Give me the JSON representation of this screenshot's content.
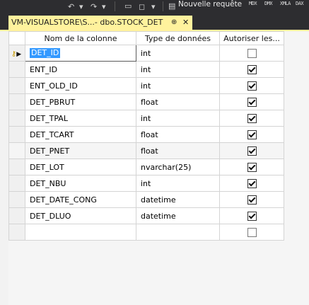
{
  "toolbar": {
    "new_query_label": "Nouvelle requête",
    "mini_labels": [
      "MDX",
      "DMX",
      "XMLA",
      "DAX"
    ]
  },
  "tab": {
    "title": "VM-VISUALSTORE\\S...- dbo.STOCK_DET",
    "pin_glyph": "⊕",
    "close_glyph": "✕"
  },
  "grid": {
    "headers": {
      "name": "Nom de la colonne",
      "type": "Type de données",
      "nulls": "Autoriser les..."
    },
    "rows": [
      {
        "name": "DET_ID",
        "type": "int",
        "allow_nulls": false
      },
      {
        "name": "ENT_ID",
        "type": "int",
        "allow_nulls": true
      },
      {
        "name": "ENT_OLD_ID",
        "type": "int",
        "allow_nulls": true
      },
      {
        "name": "DET_PBRUT",
        "type": "float",
        "allow_nulls": true
      },
      {
        "name": "DET_TPAL",
        "type": "int",
        "allow_nulls": true
      },
      {
        "name": "DET_TCART",
        "type": "float",
        "allow_nulls": true
      },
      {
        "name": "DET_PNET",
        "type": "float",
        "allow_nulls": true
      },
      {
        "name": "DET_LOT",
        "type": "nvarchar(25)",
        "allow_nulls": true
      },
      {
        "name": "DET_NBU",
        "type": "int",
        "allow_nulls": true
      },
      {
        "name": "DET_DATE_CONG",
        "type": "datetime",
        "allow_nulls": true
      },
      {
        "name": "DET_DLUO",
        "type": "datetime",
        "allow_nulls": true
      },
      {
        "name": "",
        "type": "",
        "allow_nulls": false
      }
    ],
    "highlight_color": "#f7ef00",
    "selection_color": "#3399ff"
  }
}
